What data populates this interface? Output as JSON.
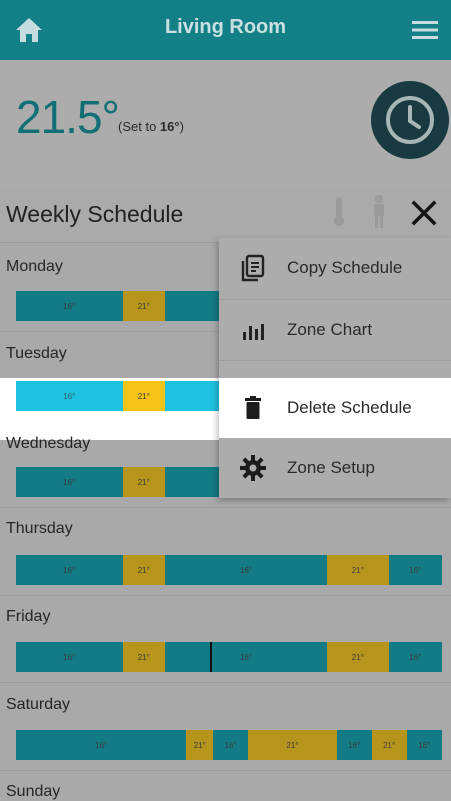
{
  "header": {
    "title": "Living Room",
    "home_icon": "home-icon",
    "menu_icon": "hamburger-menu-icon"
  },
  "status": {
    "temperature": "21.5°",
    "set_prefix": "(Set to ",
    "set_value": "16°",
    "set_suffix": ")",
    "clock_icon": "clock-icon"
  },
  "schedule": {
    "title": "Weekly Schedule",
    "days": [
      {
        "name": "Monday",
        "segments": [
          {
            "label": "16°",
            "kind": "cool",
            "fraction": 0.25
          },
          {
            "label": "21°",
            "kind": "warm",
            "fraction": 0.1
          },
          {
            "label": "",
            "kind": "cool",
            "fraction": 0.65
          }
        ]
      },
      {
        "name": "Tuesday",
        "segments": [
          {
            "label": "16°",
            "kind": "cool",
            "fraction": 0.25
          },
          {
            "label": "21°",
            "kind": "warm",
            "fraction": 0.1
          },
          {
            "label": "",
            "kind": "cool",
            "fraction": 0.65
          }
        ]
      },
      {
        "name": "Wednesday",
        "segments": [
          {
            "label": "16°",
            "kind": "cool",
            "fraction": 0.25
          },
          {
            "label": "21°",
            "kind": "warm",
            "fraction": 0.1
          },
          {
            "label": "",
            "kind": "cool",
            "fraction": 0.65
          }
        ]
      },
      {
        "name": "Thursday",
        "segments": [
          {
            "label": "16°",
            "kind": "cool",
            "fraction": 0.25
          },
          {
            "label": "21°",
            "kind": "warm",
            "fraction": 0.1
          },
          {
            "label": "16°",
            "kind": "cool",
            "fraction": 0.38
          },
          {
            "label": "21°",
            "kind": "warm",
            "fraction": 0.145
          },
          {
            "label": "16°",
            "kind": "cool",
            "fraction": 0.125
          }
        ]
      },
      {
        "name": "Friday",
        "segments": [
          {
            "label": "16°",
            "kind": "cool",
            "fraction": 0.25
          },
          {
            "label": "21°",
            "kind": "warm",
            "fraction": 0.1
          },
          {
            "label": "16°",
            "kind": "cool",
            "fraction": 0.38
          },
          {
            "label": "21°",
            "kind": "warm",
            "fraction": 0.145
          },
          {
            "label": "16°",
            "kind": "cool",
            "fraction": 0.125
          }
        ]
      },
      {
        "name": "Saturday",
        "segments": [
          {
            "label": "16°",
            "kind": "cool",
            "fraction": 0.4
          },
          {
            "label": "21°",
            "kind": "warm",
            "fraction": 0.063
          },
          {
            "label": "16°",
            "kind": "cool",
            "fraction": 0.082
          },
          {
            "label": "21°",
            "kind": "warm",
            "fraction": 0.208
          },
          {
            "label": "16°",
            "kind": "cool",
            "fraction": 0.082
          },
          {
            "label": "21°",
            "kind": "warm",
            "fraction": 0.082
          },
          {
            "label": "16°",
            "kind": "cool",
            "fraction": 0.083
          }
        ]
      },
      {
        "name": "Sunday",
        "segments": []
      }
    ]
  },
  "menu": {
    "items": [
      {
        "label": "Copy Schedule",
        "icon": "copy-icon"
      },
      {
        "label": "Zone Chart",
        "icon": "bar-chart-icon"
      },
      {
        "label": "Delete Schedule",
        "icon": "trash-icon",
        "active": true
      },
      {
        "label": "Zone Setup",
        "icon": "gear-icon"
      }
    ]
  },
  "colors": {
    "header": "#137f86",
    "cool": "#137b85",
    "warm": "#b7941b",
    "cool_highlight": "#1ec2df",
    "warm_highlight": "#f5c218"
  }
}
